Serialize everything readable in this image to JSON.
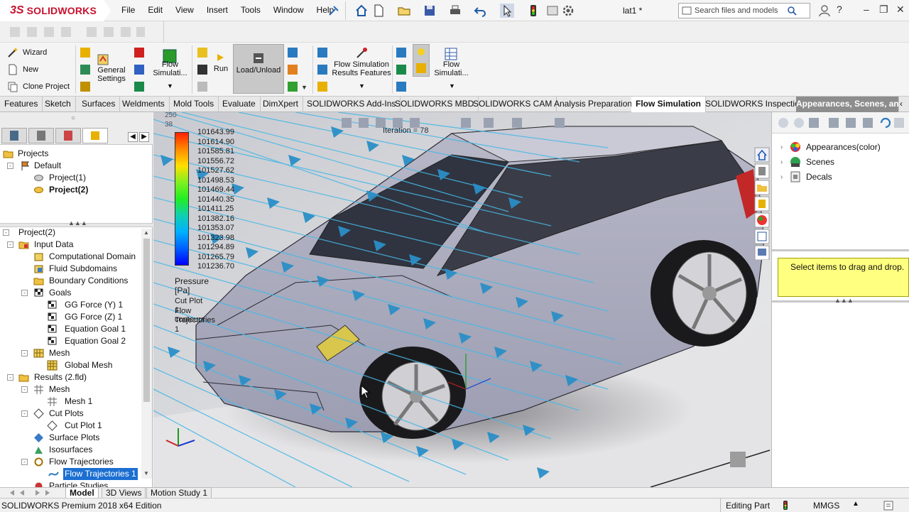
{
  "app": {
    "brand": "SOLIDWORKS",
    "menu": [
      "File",
      "Edit",
      "View",
      "Insert",
      "Tools",
      "Window",
      "Help"
    ],
    "document_title": "lat1 *",
    "search_placeholder": "Search files and models"
  },
  "command_manager": {
    "wizard": "Wizard",
    "new": "New",
    "clone_project": "Clone Project",
    "general_settings": "General Settings",
    "flow_simulation_1": "Flow Simulati...",
    "run": "Run",
    "load_unload": "Load/Unload",
    "flow_sim_results_features": "Flow Simulation Results Features",
    "flow_simulation_2": "Flow Simulati..."
  },
  "tabs": [
    "Features",
    "Sketch",
    "Surfaces",
    "Weldments",
    "Mold Tools",
    "Evaluate",
    "DimXpert",
    "SOLIDWORKS Add-Ins",
    "SOLIDWORKS MBD",
    "SOLIDWORKS CAM",
    "Analysis Preparation",
    "Flow Simulation",
    "SOLIDWORKS Inspection",
    "Appearances, Scenes, and De..."
  ],
  "projects_tree": {
    "root": "Projects",
    "default": "Default",
    "project1": "Project(1)",
    "project2": "Project(2)"
  },
  "analysis_tree": {
    "root": "Project(2)",
    "input_data": "Input Data",
    "computational_domain": "Computational Domain",
    "fluid_subdomains": "Fluid Subdomains",
    "boundary_conditions": "Boundary Conditions",
    "goals": "Goals",
    "goal1": "GG Force (Y) 1",
    "goal2": "GG Force (Z) 1",
    "goal3": "Equation Goal 1",
    "goal4": "Equation Goal 2",
    "mesh": "Mesh",
    "global_mesh": "Global Mesh",
    "results": "Results (2.fld)",
    "results_mesh": "Mesh",
    "mesh1": "Mesh 1",
    "cut_plots": "Cut Plots",
    "cut_plot1": "Cut Plot 1",
    "surface_plots": "Surface Plots",
    "isosurfaces": "Isosurfaces",
    "flow_trajectories": "Flow Trajectories",
    "flow_trajectories1": "Flow Trajectories 1",
    "particle_studies": "Particle Studies"
  },
  "viewport": {
    "iteration": "Iteration = 78",
    "legend_top_clip": "250 38",
    "legend_values": [
      "101643.99",
      "101614.90",
      "101585.81",
      "101556.72",
      "101527.62",
      "101498.53",
      "101469.44",
      "101440.35",
      "101411.25",
      "101382.16",
      "101353.07",
      "101323.98",
      "101294.89",
      "101265.79",
      "101236.70"
    ],
    "legend_title": "Pressure [Pa]",
    "plot_label1": "Cut Plot 1: contours",
    "plot_label2": "Flow Trajectories 1",
    "colors": {
      "legend_top": "#ff2200",
      "legend_mid": "#22ee22",
      "legend_bottom": "#0000ff",
      "arrow": "#2a8fc7",
      "streamline": "#48b8e6"
    }
  },
  "right_panel": {
    "appearances": "Appearances(color)",
    "scenes": "Scenes",
    "decals": "Decals",
    "drop_hint": "Select items to drag and drop."
  },
  "bottom_tabs": [
    "Model",
    "3D Views",
    "Motion Study 1"
  ],
  "status": {
    "edition": "SOLIDWORKS Premium 2018 x64 Edition",
    "mode": "Editing Part",
    "units": "MMGS"
  }
}
